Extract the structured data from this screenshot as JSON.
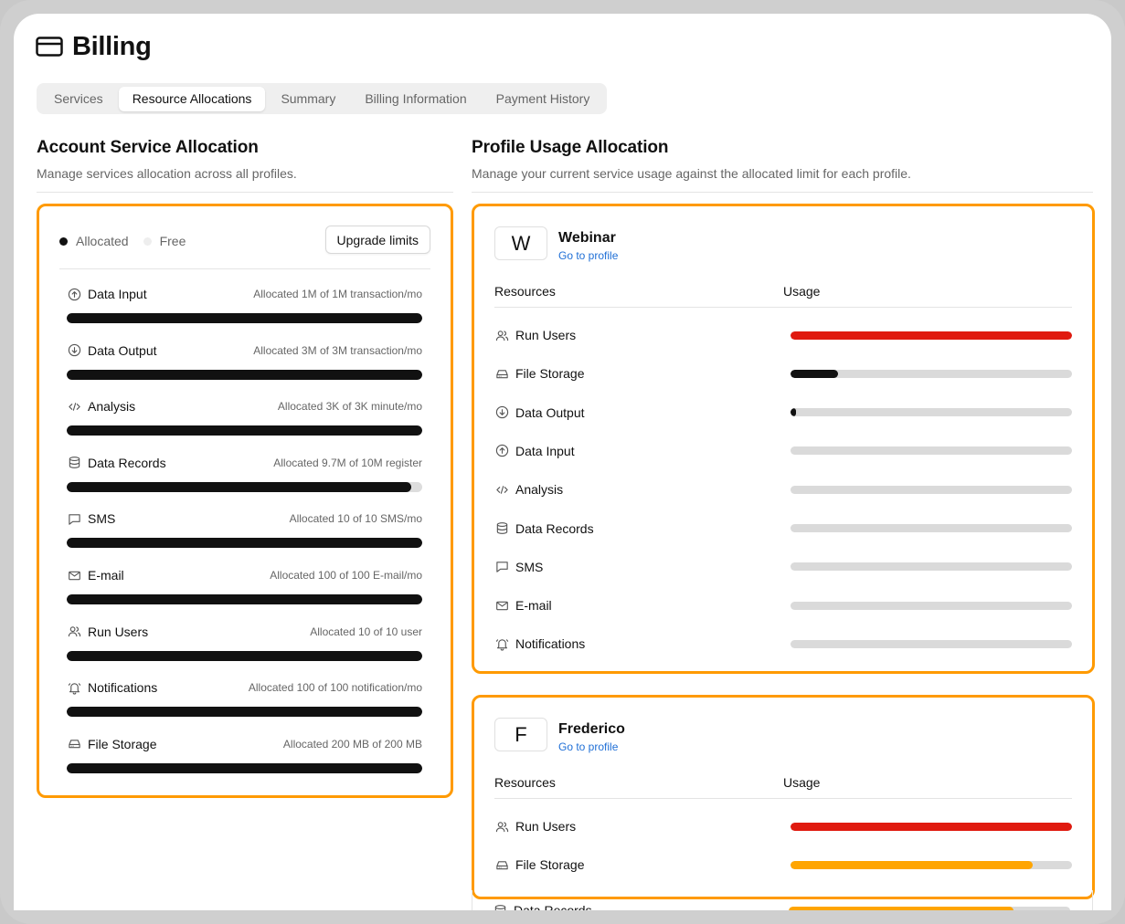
{
  "page": {
    "title": "Billing",
    "icon": "credit-card-icon"
  },
  "tabs": [
    {
      "label": "Services",
      "active": false
    },
    {
      "label": "Resource Allocations",
      "active": true
    },
    {
      "label": "Summary",
      "active": false
    },
    {
      "label": "Billing Information",
      "active": false
    },
    {
      "label": "Payment History",
      "active": false
    }
  ],
  "account": {
    "title": "Account Service Allocation",
    "subtitle": "Manage services allocation across all profiles.",
    "legend": {
      "allocated": "Allocated",
      "free": "Free"
    },
    "upgrade_label": "Upgrade limits",
    "items": [
      {
        "name": "Data Input",
        "icon": "arrow-up-circle-icon",
        "desc": "Allocated 1M of 1M transaction/mo",
        "fraction": 1.0
      },
      {
        "name": "Data Output",
        "icon": "arrow-down-circle-icon",
        "desc": "Allocated 3M of 3M transaction/mo",
        "fraction": 1.0
      },
      {
        "name": "Analysis",
        "icon": "code-icon",
        "desc": "Allocated 3K of 3K minute/mo",
        "fraction": 1.0
      },
      {
        "name": "Data Records",
        "icon": "database-icon",
        "desc": "Allocated 9.7M of 10M register",
        "fraction": 0.97
      },
      {
        "name": "SMS",
        "icon": "message-square-icon",
        "desc": "Allocated 10 of 10 SMS/mo",
        "fraction": 1.0
      },
      {
        "name": "E-mail",
        "icon": "mail-icon",
        "desc": "Allocated 100 of 100 E-mail/mo",
        "fraction": 1.0
      },
      {
        "name": "Run Users",
        "icon": "users-icon",
        "desc": "Allocated 10 of 10 user",
        "fraction": 1.0
      },
      {
        "name": "Notifications",
        "icon": "bell-icon",
        "desc": "Allocated 100 of 100 notification/mo",
        "fraction": 1.0
      },
      {
        "name": "File Storage",
        "icon": "hard-drive-icon",
        "desc": "Allocated 200 MB of 200 MB",
        "fraction": 1.0
      }
    ]
  },
  "profiles_section": {
    "title": "Profile Usage Allocation",
    "subtitle": "Manage your current service usage against the allocated limit for each profile.",
    "col_resources": "Resources",
    "col_usage": "Usage"
  },
  "profiles": [
    {
      "initial": "W",
      "name": "Webinar",
      "link": "Go to profile",
      "rows": [
        {
          "name": "Run Users",
          "icon": "users-icon",
          "fraction": 1.0,
          "color": "#e01a0f"
        },
        {
          "name": "File Storage",
          "icon": "hard-drive-icon",
          "fraction": 0.17,
          "color": "#111111"
        },
        {
          "name": "Data Output",
          "icon": "arrow-down-circle-icon",
          "fraction": 0.02,
          "color": "#111111"
        },
        {
          "name": "Data Input",
          "icon": "arrow-up-circle-icon",
          "fraction": 0.0,
          "color": "#111111"
        },
        {
          "name": "Analysis",
          "icon": "code-icon",
          "fraction": 0.0,
          "color": "#111111"
        },
        {
          "name": "Data Records",
          "icon": "database-icon",
          "fraction": 0.0,
          "color": "#111111"
        },
        {
          "name": "SMS",
          "icon": "message-square-icon",
          "fraction": 0.0,
          "color": "#111111"
        },
        {
          "name": "E-mail",
          "icon": "mail-icon",
          "fraction": 0.0,
          "color": "#111111"
        },
        {
          "name": "Notifications",
          "icon": "bell-icon",
          "fraction": 0.0,
          "color": "#111111"
        }
      ]
    },
    {
      "initial": "F",
      "name": "Frederico",
      "link": "Go to profile",
      "rows": [
        {
          "name": "Run Users",
          "icon": "users-icon",
          "fraction": 1.0,
          "color": "#e01a0f"
        },
        {
          "name": "File Storage",
          "icon": "hard-drive-icon",
          "fraction": 0.86,
          "color": "#ffa500"
        },
        {
          "name": "Data Records",
          "icon": "database-icon",
          "fraction": 0.8,
          "color": "#ffa500"
        }
      ]
    }
  ],
  "colors": {
    "highlight": "#ff9a00",
    "danger": "#e01a0f",
    "warning": "#ffa500",
    "link": "#1f6fd6"
  }
}
